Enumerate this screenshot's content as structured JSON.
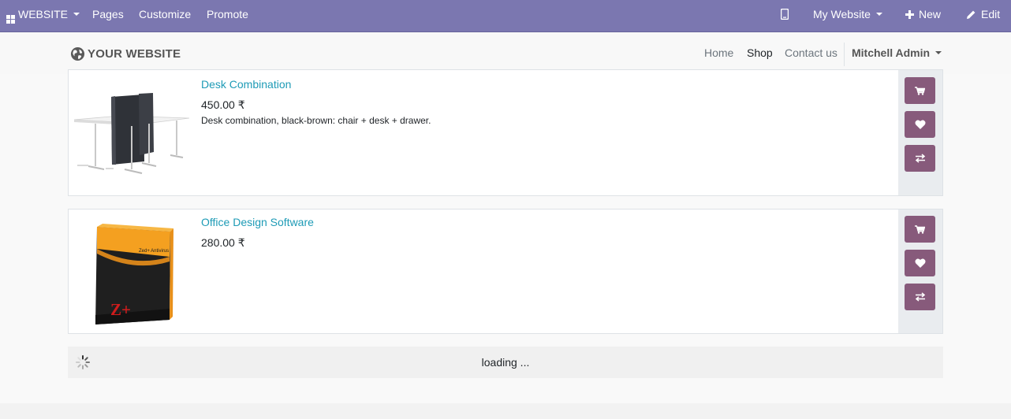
{
  "admin_bar": {
    "website_menu": "WEBSITE",
    "items": [
      "Pages",
      "Customize",
      "Promote"
    ],
    "my_website": "My Website",
    "new": "New",
    "edit": "Edit"
  },
  "header": {
    "logo_text": "YOUR WEBSITE",
    "nav": [
      "Home",
      "Shop",
      "Contact us"
    ],
    "active_nav": "Shop",
    "user": "Mitchell Admin"
  },
  "products": [
    {
      "name": "Desk Combination",
      "price": "450.00 ₹",
      "description": "Desk combination, black-brown: chair + desk + drawer."
    },
    {
      "name": "Office Design Software",
      "price": "280.00 ₹",
      "description": "",
      "box_label": "Zed+ Antivirus",
      "box_logo": "Z+"
    }
  ],
  "loading": "loading ...",
  "colors": {
    "admin_bar": "#7b77b0",
    "accent": "#875a7b",
    "link": "#1e9bb6"
  },
  "icons": {
    "cart": "cart-icon",
    "wishlist": "heart-icon",
    "compare": "exchange-icon"
  }
}
